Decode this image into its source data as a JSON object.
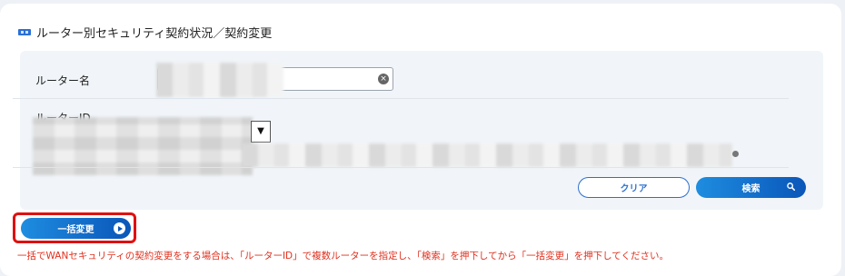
{
  "section": {
    "title": "ルーター別セキュリティ契約状況／契約変更"
  },
  "form": {
    "router_name_label": "ルーター名",
    "router_name_value": "",
    "router_id_label": "ルーターID",
    "select_arrow": "▼",
    "clear_glyph": "×"
  },
  "buttons": {
    "clear_label": "クリア",
    "search_label": "検索",
    "bulk_change_label": "一括変更"
  },
  "note": "一括でWANセキュリティの契約変更をする場合は、「ルーターID」で複数ルーターを指定し、「検索」を押下してから「一括変更」を押下してください。",
  "colors": {
    "accent": "#0a56b9",
    "highlight_border": "#e01010",
    "note_text": "#e0301e"
  }
}
